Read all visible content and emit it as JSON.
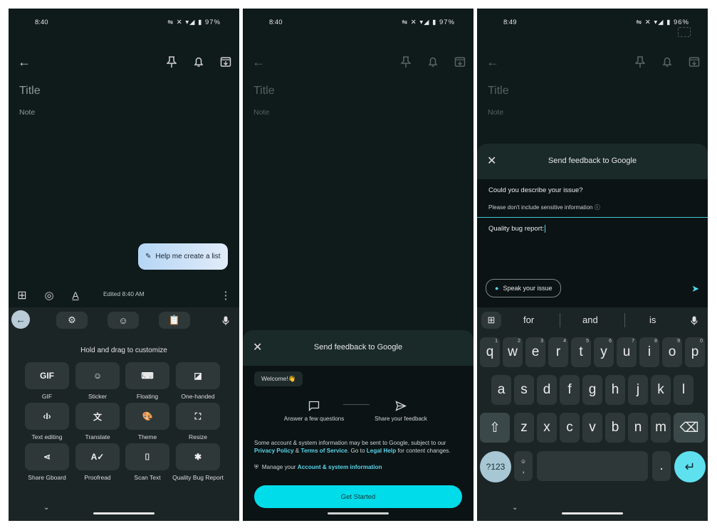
{
  "status": [
    {
      "time": "8:40",
      "battery": "97%"
    },
    {
      "time": "8:40",
      "battery": "97%"
    },
    {
      "time": "8:49",
      "battery": "96%"
    }
  ],
  "note_editor": {
    "title_placeholder": "Title",
    "note_placeholder": "Note"
  },
  "phone1": {
    "help_button": "Help me create a list",
    "edited": "Edited 8:40 AM",
    "hold_text": "Hold and drag to customize",
    "tiles": [
      {
        "icon": "gif-icon",
        "glyph": "GIF",
        "label": "GIF"
      },
      {
        "icon": "sticker-icon",
        "glyph": "☺",
        "label": "Sticker"
      },
      {
        "icon": "floating-keyboard-icon",
        "glyph": "⌨",
        "label": "Floating"
      },
      {
        "icon": "one-handed-icon",
        "glyph": "◪",
        "label": "One-handed"
      },
      {
        "icon": "text-editing-icon",
        "glyph": "‹I›",
        "label": "Text editing"
      },
      {
        "icon": "translate-icon",
        "glyph": "文",
        "label": "Translate"
      },
      {
        "icon": "theme-icon",
        "glyph": "🎨",
        "label": "Theme"
      },
      {
        "icon": "resize-icon",
        "glyph": "⛶",
        "label": "Resize"
      },
      {
        "icon": "share-icon",
        "glyph": "⋖",
        "label": "Share Gboard"
      },
      {
        "icon": "proofread-icon",
        "glyph": "A✓",
        "label": "Proofread"
      },
      {
        "icon": "scan-text-icon",
        "glyph": "⌷",
        "label": "Scan Text"
      },
      {
        "icon": "bug-icon",
        "glyph": "✱",
        "label": "Quality Bug Report"
      }
    ]
  },
  "phone2": {
    "sheet_title": "Send feedback to Google",
    "welcome": "Welcome!👋",
    "step1": "Answer a few questions",
    "step2": "Share your feedback",
    "disclaimer_pre": "Some account & system information may be sent to Google, subject to our ",
    "privacy": "Privacy Policy",
    "amp": " & ",
    "terms": "Terms of Service",
    "goto": ". Go to ",
    "legal": "Legal Help",
    "disclaimer_post": " for content changes.",
    "manage_pre": "Manage your ",
    "manage_link": "Account & system information",
    "get_started": "Get Started"
  },
  "phone3": {
    "sheet_title": "Send feedback to Google",
    "question": "Could you describe your issue?",
    "hint": "Please don't include sensitive information",
    "input_value": "Quality bug report:",
    "speak": "Speak your issue",
    "suggestions": [
      "for",
      "and",
      "is"
    ],
    "row1": [
      [
        "q",
        "1"
      ],
      [
        "w",
        "2"
      ],
      [
        "e",
        "3"
      ],
      [
        "r",
        "4"
      ],
      [
        "t",
        "5"
      ],
      [
        "y",
        "6"
      ],
      [
        "u",
        "7"
      ],
      [
        "i",
        "8"
      ],
      [
        "o",
        "9"
      ],
      [
        "p",
        "0"
      ]
    ],
    "row2": [
      "a",
      "s",
      "d",
      "f",
      "g",
      "h",
      "j",
      "k",
      "l"
    ],
    "row3": [
      "z",
      "x",
      "c",
      "v",
      "b",
      "n",
      "m"
    ],
    "sym_key": "?123",
    "comma": ",",
    "period": "."
  }
}
